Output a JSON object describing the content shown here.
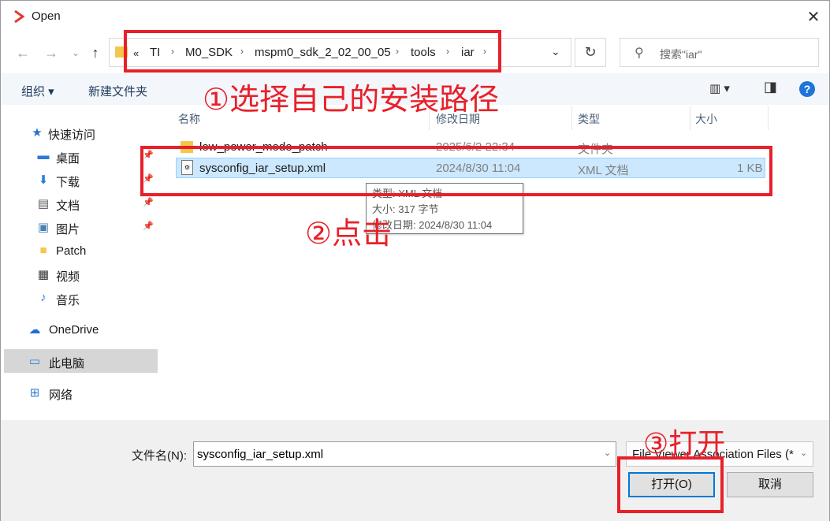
{
  "window": {
    "title": "Open",
    "close_glyph": "✕"
  },
  "address": {
    "overflow": "«",
    "crumbs": [
      "TI",
      "M0_SDK",
      "mspm0_sdk_2_02_00_05",
      "tools",
      "iar"
    ],
    "separator": "›",
    "dropdown_glyph": "⌄",
    "refresh_glyph": "↻"
  },
  "nav": {
    "back": "←",
    "forward": "→",
    "recent": "⌄",
    "up": "↑"
  },
  "search": {
    "icon": "⚲",
    "placeholder": "搜索\"iar\""
  },
  "toolbar": {
    "organize": "组织 ▾",
    "new_folder": "新建文件夹",
    "view_glyph": "▥ ▾",
    "pane_glyph": "◨",
    "help": "?"
  },
  "sidebar": {
    "items": [
      {
        "label": "快速访问",
        "icon": "★",
        "icon_color": "#2b6fcf"
      },
      {
        "label": "桌面",
        "icon": "▬",
        "icon_color": "#2b7bd6",
        "pinned": "📌"
      },
      {
        "label": "下载",
        "icon": "⬇",
        "icon_color": "#2b7bd6",
        "pinned": "📌"
      },
      {
        "label": "文档",
        "icon": "▤",
        "icon_color": "#555555",
        "pinned": "📌"
      },
      {
        "label": "图片",
        "icon": "▣",
        "icon_color": "#4a7fb0",
        "pinned": "📌"
      },
      {
        "label": "Patch",
        "icon": "■",
        "icon_color": "#f3c84a"
      },
      {
        "label": "视频",
        "icon": "▦",
        "icon_color": "#333333"
      },
      {
        "label": "音乐",
        "icon": "♪",
        "icon_color": "#2b7bd6"
      },
      {
        "label": "OneDrive",
        "icon": "☁",
        "icon_color": "#1f6fd0"
      },
      {
        "label": "此电脑",
        "icon": "▭",
        "icon_color": "#2b7bd6"
      },
      {
        "label": "网络",
        "icon": "⊞",
        "icon_color": "#2b7bd6"
      }
    ]
  },
  "files": {
    "columns": [
      "名称",
      "修改日期",
      "类型",
      "大小"
    ],
    "rows": [
      {
        "name": "low_power_mode_patch",
        "date": "2025/6/2 22:34",
        "type": "文件夹",
        "size": ""
      },
      {
        "name": "sysconfig_iar_setup.xml",
        "date": "2024/8/30 11:04",
        "type": "XML 文档",
        "size": "1 KB"
      }
    ]
  },
  "tooltip": {
    "line1": "类型: XML 文档",
    "line2": "大小: 317 字节",
    "line3": "修改日期: 2024/8/30 11:04"
  },
  "bottom": {
    "filename_label": "文件名(N):",
    "filename_value": "sysconfig_iar_setup.xml",
    "filter": "File Viewer Association Files (*",
    "open": "打开(O)",
    "cancel": "取消"
  },
  "annotations": {
    "step1": "①选择自己的安装路径",
    "step2": "②点击",
    "step3": "③打开",
    "color": "#e8202a"
  }
}
